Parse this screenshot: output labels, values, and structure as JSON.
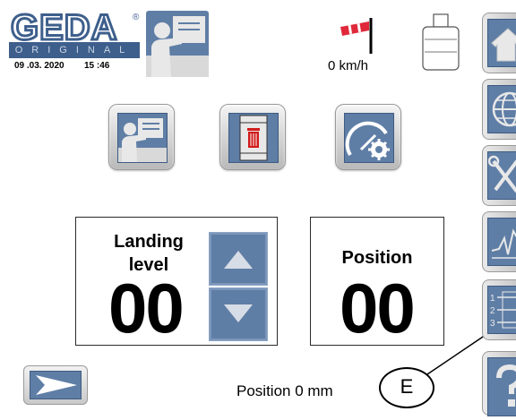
{
  "header": {
    "logo_text": "GEDA",
    "logo_sub": "ORIGINAL",
    "date": "09 .03. 2020",
    "time": "15 :46",
    "wind_speed": "0 km/h"
  },
  "toolbar": {
    "icons": [
      "operator-icon",
      "cage-trash-icon",
      "gauge-settings-icon"
    ]
  },
  "landing_panel": {
    "title_line1": "Landing",
    "title_line2": "level",
    "value": "00"
  },
  "position_panel": {
    "title": "Position",
    "value": "00"
  },
  "status": {
    "position_text": "Position  0 mm"
  },
  "callout": {
    "label": "E"
  },
  "sidebar": {
    "items": [
      "home-icon",
      "globe-icon",
      "tools-icon",
      "chart-icon",
      "floor-list-icon",
      "help-icon"
    ]
  },
  "colors": {
    "button_blue": "#5f7ea6",
    "logo_blue": "#3e5f8c",
    "wind_red": "#e0283a"
  }
}
